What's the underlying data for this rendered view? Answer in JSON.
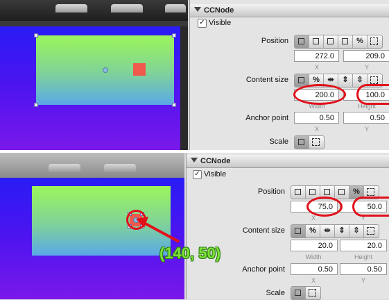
{
  "top": {
    "section_title": "CCNode",
    "visible_label": "Visible",
    "visible_checked": "✓",
    "position_label": "Position",
    "position_x": "272.0",
    "position_y": "209.0",
    "x_cap": "X",
    "y_cap": "Y",
    "content_size_label": "Content size",
    "content_w": "200.0",
    "content_h": "100.0",
    "width_cap": "Width",
    "height_cap": "Height",
    "anchor_label": "Anchor point",
    "anchor_x": "0.50",
    "anchor_y": "0.50",
    "scale_label": "Scale"
  },
  "bottom": {
    "section_title": "CCNode",
    "visible_label": "Visible",
    "visible_checked": "✓",
    "position_label": "Position",
    "position_x": "75.0",
    "position_y": "50.0",
    "x_cap": "X",
    "y_cap": "Y",
    "content_size_label": "Content size",
    "content_w": "20.0",
    "content_h": "20.0",
    "width_cap": "Width",
    "height_cap": "Height",
    "anchor_label": "Anchor point",
    "anchor_x": "0.50",
    "anchor_y": "0.50",
    "scale_label": "Scale"
  },
  "annotation": "(140, 50)",
  "segment_icons": {
    "percent": "%"
  },
  "colors": {
    "highlight_ring": "#e2101a",
    "annotation_text": "#7ee23a",
    "arrow": "#e2101a"
  }
}
